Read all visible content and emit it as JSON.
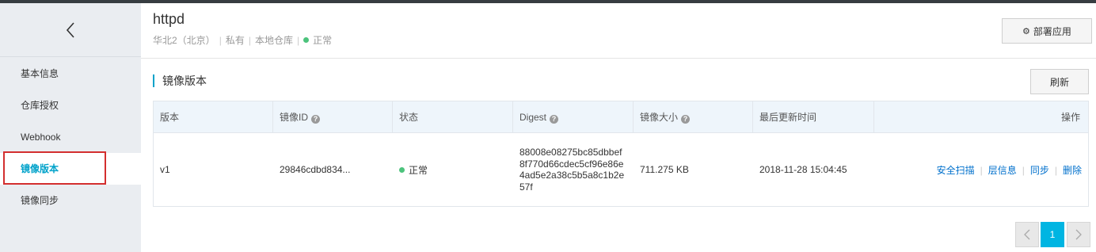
{
  "sidebar": {
    "items": [
      {
        "label": "基本信息"
      },
      {
        "label": "仓库授权"
      },
      {
        "label": "Webhook"
      },
      {
        "label": "镜像版本"
      },
      {
        "label": "镜像同步"
      }
    ]
  },
  "header": {
    "title": "httpd",
    "region": "华北2（北京）",
    "visibility": "私有",
    "repo_type": "本地仓库",
    "status": "正常",
    "deploy_label": "部署应用"
  },
  "section": {
    "title": "镜像版本",
    "refresh_label": "刷新"
  },
  "table": {
    "columns": [
      "版本",
      "镜像ID",
      "状态",
      "Digest",
      "镜像大小",
      "最后更新时间",
      "操作"
    ],
    "rows": [
      {
        "version": "v1",
        "image_id": "29846cdbd834...",
        "status": "正常",
        "digest": "88008e08275bc85dbbef8f770d66cdec5cf96e86e4ad5e2a38c5b5a8c1b2e57f",
        "size": "711.275 KB",
        "updated": "2018-11-28 15:04:45",
        "actions": [
          "安全扫描",
          "层信息",
          "同步",
          "删除"
        ]
      }
    ]
  },
  "pagination": {
    "current": "1",
    "prev": "‹",
    "next": "›"
  },
  "colors": {
    "accent": "#00a2ca",
    "status_ok": "#4cc37c",
    "highlight": "#d32f2f"
  }
}
